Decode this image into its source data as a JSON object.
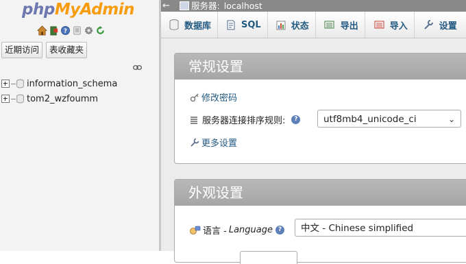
{
  "nav": {
    "logo_php": "php",
    "logo_myadmin": "MyAdmin",
    "icons": [
      "home-icon",
      "exit-icon",
      "help-icon",
      "docs-icon",
      "settings-icon",
      "reload-icon"
    ],
    "recent_label": "近期访问",
    "favorites_label": "表收藏夹",
    "databases": [
      "information_schema",
      "tom2_wzfoumm"
    ]
  },
  "topbar": {
    "back_arrow": "←",
    "server_label": "服务器:",
    "server_value": "localhost"
  },
  "menu": {
    "tabs": [
      {
        "label": "数据库",
        "icon": "database-icon"
      },
      {
        "label": "SQL",
        "icon": "sql-icon"
      },
      {
        "label": "状态",
        "icon": "status-icon"
      },
      {
        "label": "导出",
        "icon": "export-icon"
      },
      {
        "label": "导入",
        "icon": "import-icon"
      },
      {
        "label": "设置",
        "icon": "settings-icon"
      }
    ]
  },
  "general": {
    "title": "常规设置",
    "change_password": "修改密码",
    "collation_label": "服务器连接排序规则:",
    "collation_value": "utf8mb4_unicode_ci",
    "more_settings": "更多设置"
  },
  "appearance": {
    "title": "外观设置",
    "language_label": "语言 - ",
    "language_label_en": "Language",
    "language_value": "中文 - Chinese simplified"
  },
  "colors": {
    "logo_php": "#6c78af",
    "logo_myadmin": "#f89c0e",
    "link": "#235a81",
    "group_header": "#a8a8a8",
    "topbar": "#888888"
  }
}
